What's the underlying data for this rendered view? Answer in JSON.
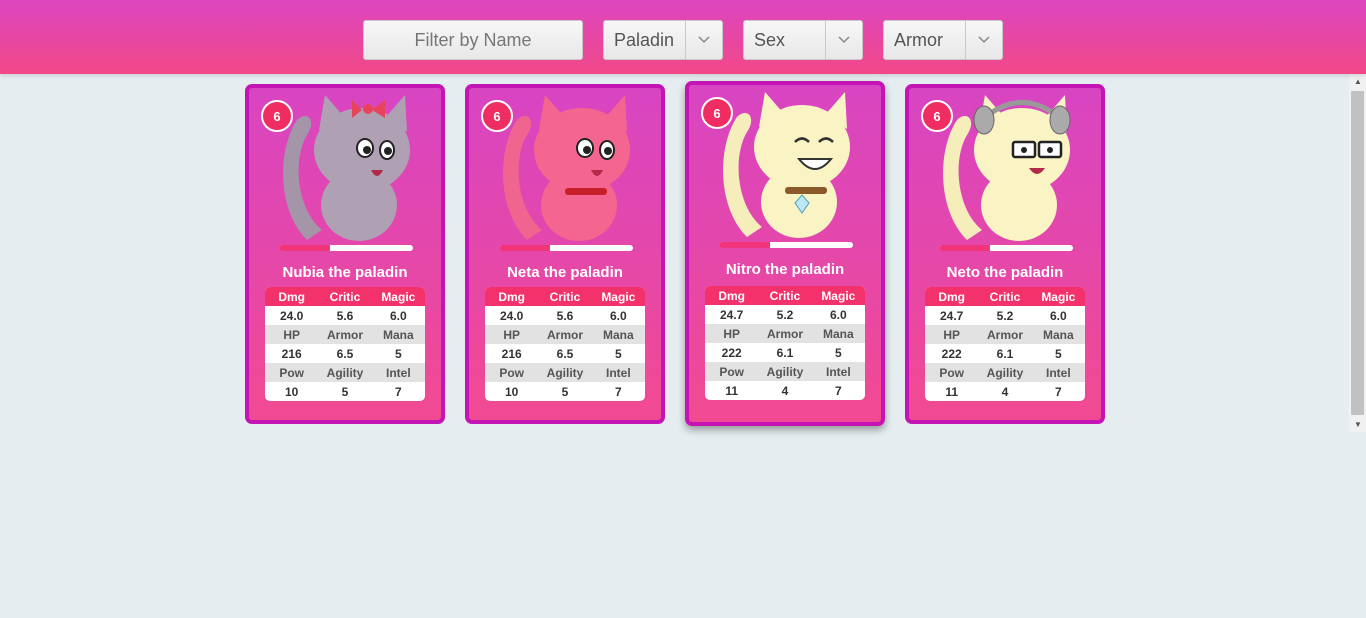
{
  "filter": {
    "placeholder": "Filter by Name"
  },
  "selects": [
    {
      "value": "Paladin"
    },
    {
      "value": "Sex"
    },
    {
      "value": "Armor"
    }
  ],
  "cards": [
    {
      "level": "6",
      "name": "Nubia the paladin",
      "progress": 0.38,
      "stats": {
        "Dmg": "24.0",
        "Critic": "5.6",
        "Magic": "6.0",
        "HP": "216",
        "Armor": "6.5",
        "Mana": "5",
        "Pow": "10",
        "Agility": "5",
        "Intel": "7"
      }
    },
    {
      "level": "6",
      "name": "Neta the paladin",
      "progress": 0.38,
      "stats": {
        "Dmg": "24.0",
        "Critic": "5.6",
        "Magic": "6.0",
        "HP": "216",
        "Armor": "6.5",
        "Mana": "5",
        "Pow": "10",
        "Agility": "5",
        "Intel": "7"
      }
    },
    {
      "level": "6",
      "name": "Nitro the paladin",
      "progress": 0.38,
      "stats": {
        "Dmg": "24.7",
        "Critic": "5.2",
        "Magic": "6.0",
        "HP": "222",
        "Armor": "6.1",
        "Mana": "5",
        "Pow": "11",
        "Agility": "4",
        "Intel": "7"
      }
    },
    {
      "level": "6",
      "name": "Neto the paladin",
      "progress": 0.38,
      "stats": {
        "Dmg": "24.7",
        "Critic": "5.2",
        "Magic": "6.0",
        "HP": "222",
        "Armor": "6.1",
        "Mana": "5",
        "Pow": "11",
        "Agility": "4",
        "Intel": "7"
      }
    }
  ],
  "stat_labels": [
    "Dmg",
    "Critic",
    "Magic",
    "HP",
    "Armor",
    "Mana",
    "Pow",
    "Agility",
    "Intel"
  ],
  "colors": {
    "header_top": "#dc46c0",
    "header_bottom": "#f24888",
    "card_border": "#c415b4",
    "accent": "#f02d62"
  }
}
